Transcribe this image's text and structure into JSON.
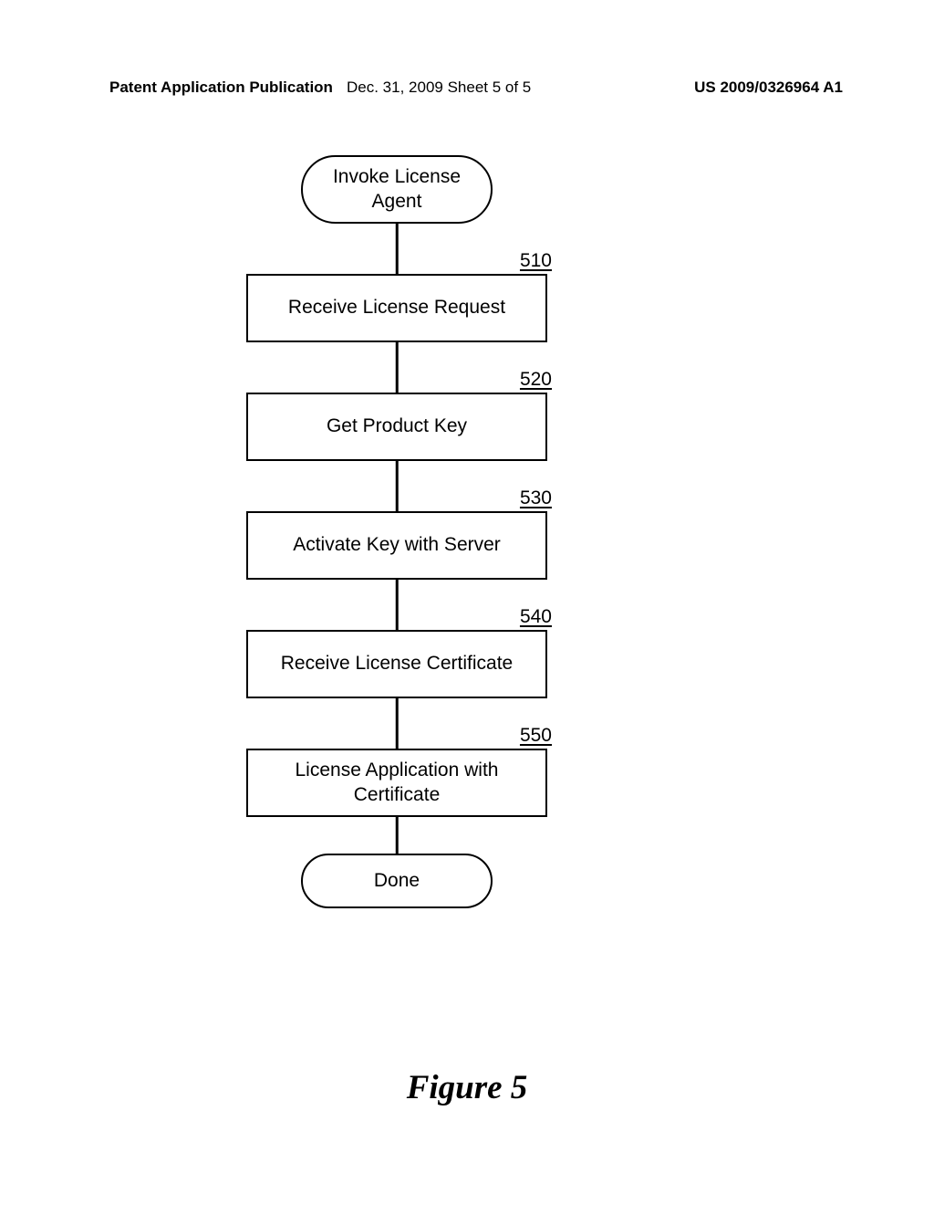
{
  "header": {
    "left": "Patent Application Publication",
    "center": "Dec. 31, 2009  Sheet 5 of 5",
    "right": "US 2009/0326964 A1"
  },
  "flowchart": {
    "start": "Invoke License\nAgent",
    "steps": [
      {
        "ref": "510",
        "text": "Receive License Request"
      },
      {
        "ref": "520",
        "text": "Get Product Key"
      },
      {
        "ref": "530",
        "text": "Activate Key with Server"
      },
      {
        "ref": "540",
        "text": "Receive License Certificate"
      },
      {
        "ref": "550",
        "text": "License Application with\nCertificate"
      }
    ],
    "end": "Done"
  },
  "figure_title": "Figure 5"
}
